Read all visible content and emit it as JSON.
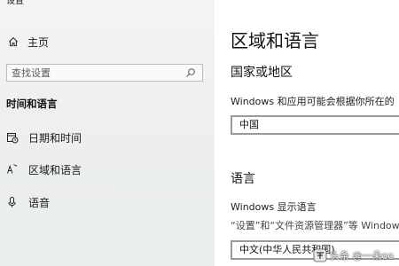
{
  "window": {
    "title": "设置"
  },
  "sidebar": {
    "home_label": "主页",
    "search_placeholder": "查找设置",
    "section_heading": "时间和语言",
    "items": [
      {
        "label": "日期和时间",
        "icon": "calendar-clock-icon"
      },
      {
        "label": "区域和语言",
        "icon": "region-language-icon"
      },
      {
        "label": "语音",
        "icon": "microphone-icon"
      }
    ]
  },
  "main": {
    "title": "区域和语言",
    "country_heading": "国家或地区",
    "country_desc": "Windows 和应用可能会根据你所在的",
    "country_value": "中国",
    "language_heading": "语言",
    "display_language_label": "Windows 显示语言",
    "display_language_desc": "“设置”和“文件资源管理器”等 Window",
    "display_language_value": "中文(中华人民共和国)"
  },
  "watermark": {
    "text": "头条 @一朵oo"
  },
  "colors": {
    "sidebar_bg": "#eef0f0",
    "main_bg": "#ffffff",
    "dropdown_border": "#9a9a9a"
  }
}
